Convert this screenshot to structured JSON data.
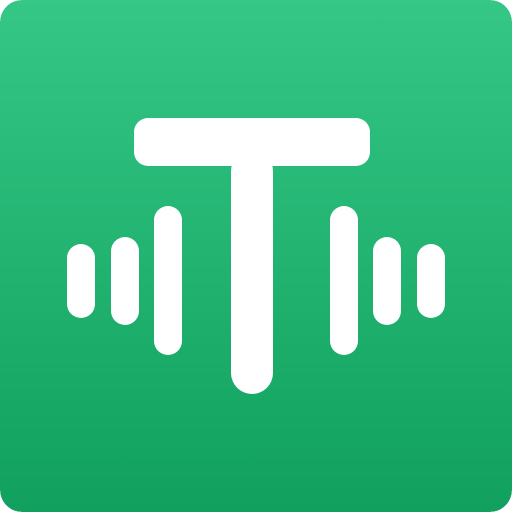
{
  "icon": {
    "name": "transcription-app-icon",
    "glyph": "T-with-sound-waves",
    "colors": {
      "background_top": "#34C785",
      "background_bottom": "#11A05E",
      "foreground": "#FFFFFF"
    }
  }
}
